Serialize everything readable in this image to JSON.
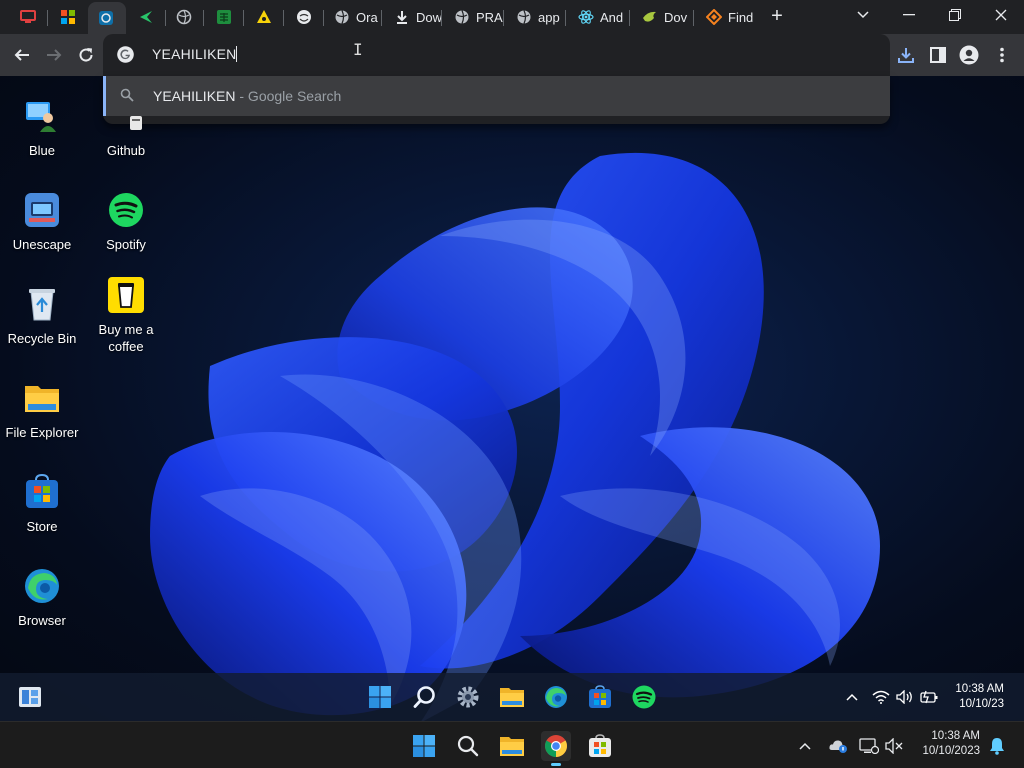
{
  "browser": {
    "tabs": [
      {
        "label": "",
        "icon": "computer-icon"
      },
      {
        "label": "",
        "icon": "windows-logo-icon"
      },
      {
        "label": "",
        "icon": "app-icon",
        "active": true
      },
      {
        "label": "",
        "icon": "arrow-icon"
      },
      {
        "label": "",
        "icon": "globe-icon"
      },
      {
        "label": "",
        "icon": "spreadsheet-icon"
      },
      {
        "label": "",
        "icon": "bug-icon"
      },
      {
        "label": "",
        "icon": "troll-face-icon"
      },
      {
        "label": "Ora",
        "icon": "globe-icon"
      },
      {
        "label": "Dow",
        "icon": "download-icon"
      },
      {
        "label": "PRA",
        "icon": "globe-icon"
      },
      {
        "label": "app",
        "icon": "globe-icon"
      },
      {
        "label": "And",
        "icon": "react-icon"
      },
      {
        "label": "Dov",
        "icon": "dove-icon"
      },
      {
        "label": "Find",
        "icon": "diamond-icon"
      }
    ],
    "new_tab": "+",
    "omnibox_value": "YEAHILIKEN",
    "suggestion": {
      "query": "YEAHILIKEN",
      "suffix": " - Google Search"
    }
  },
  "desktop": {
    "icons": [
      {
        "label": "Blue"
      },
      {
        "label": "Github"
      },
      {
        "label": "Unescape"
      },
      {
        "label": "Spotify"
      },
      {
        "label": "Recycle Bin"
      },
      {
        "label": "Buy me a coffee"
      },
      {
        "label": "File Explorer"
      },
      {
        "label": "Store"
      },
      {
        "label": "Browser"
      }
    ]
  },
  "vm_taskbar": {
    "time": "10:38 AM",
    "date": "10/10/23"
  },
  "host_taskbar": {
    "time": "10:38 AM",
    "date": "10/10/2023"
  },
  "colors": {
    "accent": "#8ab4f8",
    "chrome_dark": "#202124",
    "chrome_toolbar": "#35363a",
    "spotify": "#1ed760",
    "taskbar_indicator": "#60cdff"
  }
}
